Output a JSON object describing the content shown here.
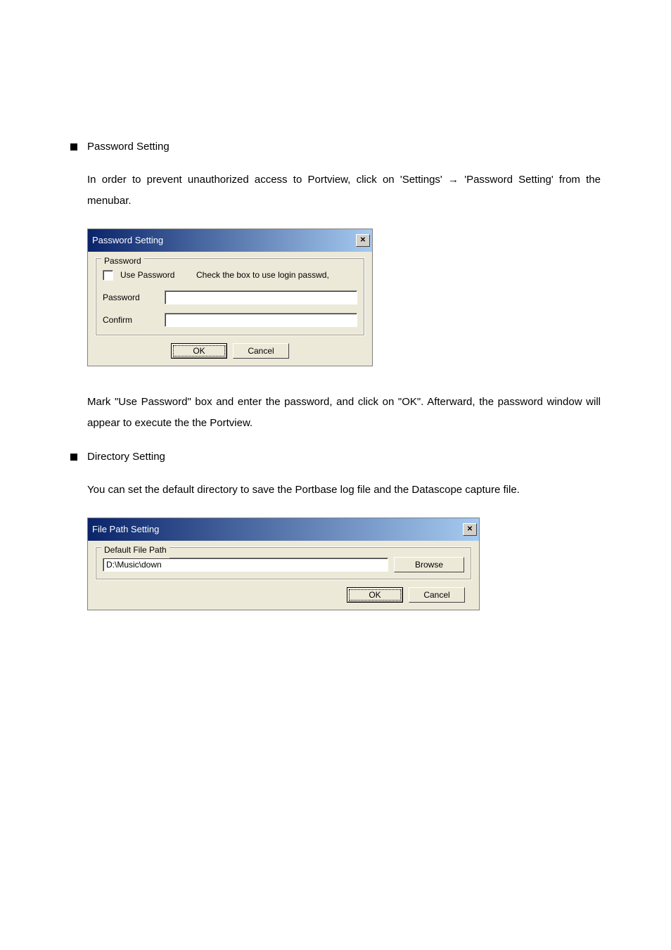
{
  "sections": {
    "pw": {
      "heading": "Password Setting",
      "para1_pre": "In order to prevent unauthorized access to Portview, click on 'Settings' ",
      "arrow": "→",
      "para1_post": " 'Password Setting' from the menubar.",
      "para2": "Mark \"Use Password\" box and enter the password, and click on \"OK\". Afterward, the password window will appear to execute the the Portview."
    },
    "dir": {
      "heading": "Directory Setting",
      "para1": "You can set the default directory to save the Portbase log file and the Datascope capture file."
    }
  },
  "dialog1": {
    "title": "Password Setting",
    "close": "✕",
    "group_legend": "Password",
    "use_password_label": "Use Password",
    "use_password_hint": "Check the box to use login passwd,",
    "password_label": "Password",
    "confirm_label": "Confirm",
    "ok": "OK",
    "cancel": "Cancel",
    "password_value": "",
    "confirm_value": ""
  },
  "dialog2": {
    "title": "File Path Setting",
    "close": "✕",
    "group_legend": "Default File Path",
    "path_value": "D:\\Music\\down",
    "browse": "Browse",
    "ok": "OK",
    "cancel": "Cancel"
  }
}
